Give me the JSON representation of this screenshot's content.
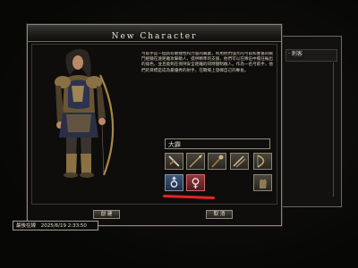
{
  "dialog": {
    "title": "New Character",
    "description": "弓箭手是一個具有敏捷性和力量的職業，利用他們強大的弓箭和豐富的戰鬥經驗在遠距離攻擊敵人，提供精準的支援，他們可以在隊伍中擔任輸出的角色，並且能夠在保持安全距離的同時壓制敵人。作為一名弓箭手，他們的目標是成為最優秀的射手，在戰場上發揮自己的專長。",
    "name_value": "大霹",
    "ok_label": "創 建",
    "cancel_label": "取 消"
  },
  "background": {
    "row_text": "· 刺客"
  },
  "class_icons": [
    "sword-icon",
    "spear-icon",
    "staff-icon",
    "dual-blades-icon",
    "bow-icon",
    "glove-icon"
  ],
  "gender": {
    "selected": "female"
  },
  "status_bar": {
    "label": "最後在線",
    "timestamp": "2025/6/19 2:33:50"
  },
  "colors": {
    "accent_red": "#e4232a",
    "female_button": "#93373b",
    "male_button": "#3e5879"
  }
}
